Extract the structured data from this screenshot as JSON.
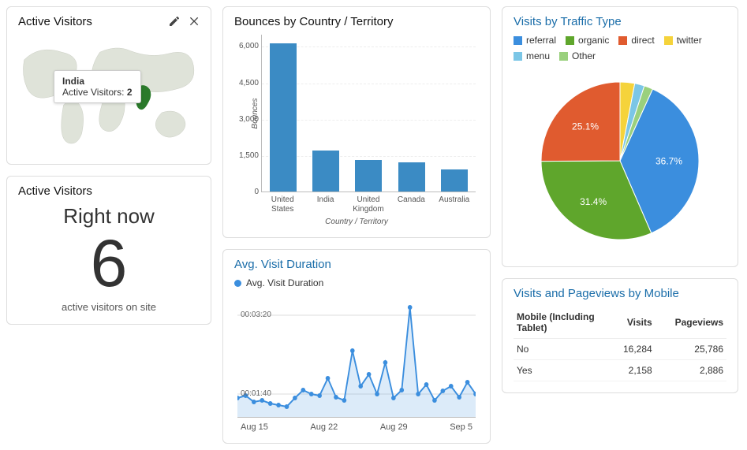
{
  "colors": {
    "referral": "#3B8EDE",
    "organic": "#5FA62C",
    "direct": "#E05B2F",
    "twitter": "#F5D33B",
    "menu": "#7BC6E6",
    "other": "#9AD07D",
    "bar": "#3b8bc4",
    "line": "#3B8EDE"
  },
  "map_card": {
    "title": "Active Visitors",
    "tooltip_country": "India",
    "tooltip_label": "Active Visitors:",
    "tooltip_value": "2"
  },
  "realtime": {
    "title": "Active Visitors",
    "label": "Right now",
    "value": "6",
    "sub": "active visitors on site"
  },
  "bounces": {
    "title": "Bounces by Country / Territory",
    "ylabel": "Bounces",
    "xlabel": "Country / Territory"
  },
  "duration": {
    "title": "Avg. Visit Duration",
    "legend": "Avg. Visit Duration"
  },
  "traffic": {
    "title": "Visits by Traffic Type"
  },
  "mobile": {
    "title": "Visits and Pageviews by Mobile",
    "headers": [
      "Mobile (Including Tablet)",
      "Visits",
      "Pageviews"
    ],
    "rows": [
      {
        "label": "No",
        "visits": "16,284",
        "pageviews": "25,786"
      },
      {
        "label": "Yes",
        "visits": "2,158",
        "pageviews": "2,886"
      }
    ]
  },
  "chart_data": [
    {
      "id": "bounces",
      "type": "bar",
      "title": "Bounces by Country / Territory",
      "xlabel": "Country / Territory",
      "ylabel": "Bounces",
      "ylim": [
        0,
        6500
      ],
      "yticks": [
        0,
        1500,
        3000,
        4500,
        6000
      ],
      "categories": [
        "United States",
        "India",
        "United Kingdom",
        "Canada",
        "Australia"
      ],
      "values": [
        6100,
        1700,
        1300,
        1200,
        900
      ]
    },
    {
      "id": "traffic",
      "type": "pie",
      "title": "Visits by Traffic Type",
      "series": [
        {
          "name": "referral",
          "value": 36.7,
          "label": "36.7%",
          "color": "#3B8EDE"
        },
        {
          "name": "organic",
          "value": 31.4,
          "label": "31.4%",
          "color": "#5FA62C"
        },
        {
          "name": "direct",
          "value": 25.1,
          "label": "25.1%",
          "color": "#E05B2F"
        },
        {
          "name": "twitter",
          "value": 3.0,
          "label": "",
          "color": "#F5D33B"
        },
        {
          "name": "menu",
          "value": 2.0,
          "label": "",
          "color": "#7BC6E6"
        },
        {
          "name": "Other",
          "value": 1.8,
          "label": "",
          "color": "#9AD07D"
        }
      ]
    },
    {
      "id": "duration",
      "type": "line",
      "title": "Avg. Visit Duration",
      "yticks_labels": [
        "00:01:40",
        "00:03:20"
      ],
      "yticks_seconds": [
        100,
        200
      ],
      "ylim_seconds": [
        70,
        230
      ],
      "x_labels": [
        "Aug 15",
        "Aug 22",
        "Aug 29",
        "Sep 5"
      ],
      "values_seconds": [
        95,
        98,
        90,
        92,
        88,
        86,
        84,
        95,
        105,
        100,
        98,
        120,
        96,
        92,
        155,
        110,
        125,
        100,
        140,
        95,
        105,
        210,
        100,
        112,
        92,
        104,
        110,
        96,
        115,
        100
      ]
    },
    {
      "id": "mobile",
      "type": "table",
      "title": "Visits and Pageviews by Mobile",
      "columns": [
        "Mobile (Including Tablet)",
        "Visits",
        "Pageviews"
      ],
      "rows": [
        [
          "No",
          16284,
          25786
        ],
        [
          "Yes",
          2158,
          2886
        ]
      ]
    }
  ]
}
